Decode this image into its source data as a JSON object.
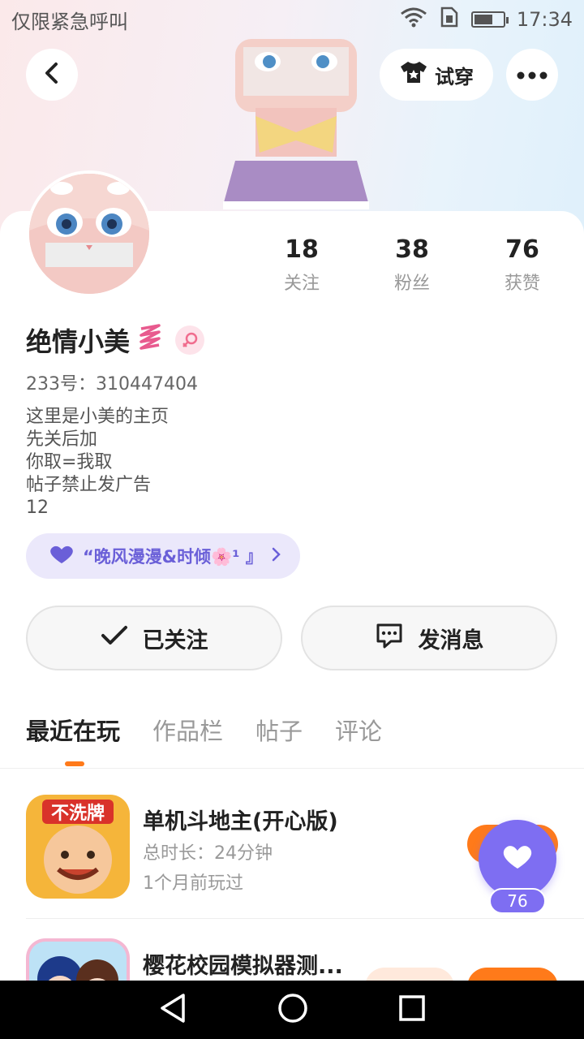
{
  "status_bar": {
    "carrier": "仅限紧急呼叫",
    "time": "17:34"
  },
  "header": {
    "tryon_label": "试穿"
  },
  "profile": {
    "name": "绝情小美",
    "uid": "233号：310447404",
    "bio": [
      "这里是小美的主页",
      "先关后加",
      "你取=我取",
      "帖子禁止发广告",
      "12"
    ],
    "guild": "“晚风漫漫&时倾🌸¹ 』"
  },
  "stats": [
    {
      "value": "18",
      "label": "关注"
    },
    {
      "value": "38",
      "label": "粉丝"
    },
    {
      "value": "76",
      "label": "获赞"
    }
  ],
  "actions": {
    "follow_label": "已关注",
    "message_label": "发消息"
  },
  "tabs": [
    {
      "label": "最近在玩"
    },
    {
      "label": "作品栏"
    },
    {
      "label": "帖子"
    },
    {
      "label": "评论"
    }
  ],
  "games": [
    {
      "title": "单机斗地主(开心版)",
      "duration": "总时长：24分钟",
      "last_played": "1个月前玩过",
      "icon_text": "不洗牌"
    },
    {
      "title": "樱花校园模拟器测..."
    }
  ],
  "like_badge": {
    "count": "76"
  },
  "colors": {
    "accent_orange": "#ff7a1a",
    "accent_purple": "#7e6ef2",
    "guild_bg": "#ebe8fb"
  }
}
